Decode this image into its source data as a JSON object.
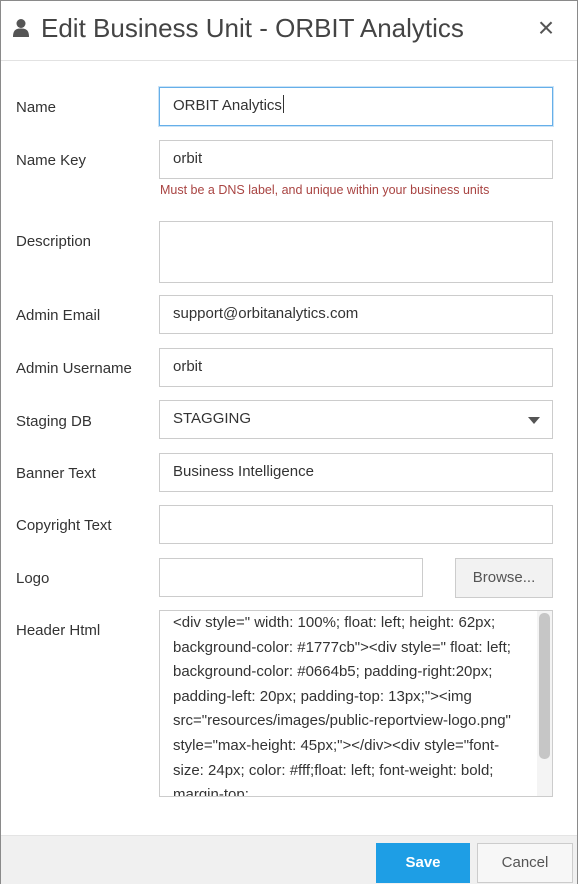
{
  "dialog": {
    "title": "Edit Business Unit - ORBIT Analytics",
    "close_label": "×",
    "icons": {
      "title_icon": "user-icon",
      "close": "close-icon",
      "dropdown": "chevron-down-icon"
    }
  },
  "form": {
    "name": {
      "label": "Name",
      "value": "ORBIT Analytics"
    },
    "name_key": {
      "label": "Name Key",
      "value": "orbit",
      "help": "Must be a DNS label, and unique within your business units"
    },
    "description": {
      "label": "Description",
      "value": ""
    },
    "admin_email": {
      "label": "Admin Email",
      "value": "support@orbitanalytics.com"
    },
    "admin_username": {
      "label": "Admin Username",
      "value": "orbit"
    },
    "staging_db": {
      "label": "Staging DB",
      "value": "STAGGING"
    },
    "banner_text": {
      "label": "Banner Text",
      "value": "Business Intelligence"
    },
    "copyright_text": {
      "label": "Copyright Text",
      "value": ""
    },
    "logo": {
      "label": "Logo",
      "value": "",
      "browse_label": "Browse..."
    },
    "header_html": {
      "label": "Header Html",
      "value": "<div style=\" width: 100%; float: left; height: 62px; background-color: #1777cb\"><div style=\" float: left; background-color: #0664b5; padding-right:20px; padding-left: 20px; padding-top: 13px;\"><img src=\"resources/images/public-reportview-logo.png\" style=\"max-height: 45px;\"></div><div style=\"font-size: 24px; color: #fff;float: left; font-weight: bold; margin-top:"
    }
  },
  "footer": {
    "save_label": "Save",
    "cancel_label": "Cancel"
  },
  "colors": {
    "primary": "#1e9ee5",
    "error": "#a94442",
    "focus": "#66afe9"
  }
}
